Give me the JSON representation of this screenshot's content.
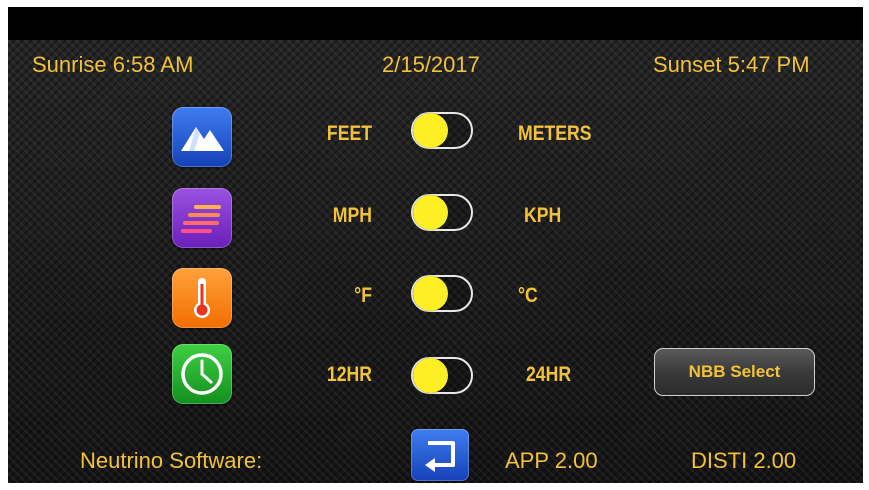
{
  "header": {
    "sunrise": "Sunrise 6:58 AM",
    "date": "2/15/2017",
    "sunset": "Sunset 5:47 PM"
  },
  "settings": [
    {
      "icon": "mountain-icon",
      "left_label": "FEET",
      "right_label": "METERS",
      "value": "FEET"
    },
    {
      "icon": "speed-lines-icon",
      "left_label": "MPH",
      "right_label": "KPH",
      "value": "MPH"
    },
    {
      "icon": "thermometer-icon",
      "left_label": "°F",
      "right_label": "°C",
      "value": "°F"
    },
    {
      "icon": "clock-icon",
      "left_label": "12HR",
      "right_label": "24HR",
      "value": "12HR"
    }
  ],
  "nbb_button": {
    "label": "NBB Select"
  },
  "footer": {
    "software_label": "Neutrino Software:",
    "back_icon": "return-arrow-icon",
    "app_version": "APP 2.00",
    "disti_version": "DISTI 2.00"
  },
  "colors": {
    "accent_text": "#f2c23b",
    "toggle_knob": "#fdef24",
    "background": "#1b1b1b"
  }
}
